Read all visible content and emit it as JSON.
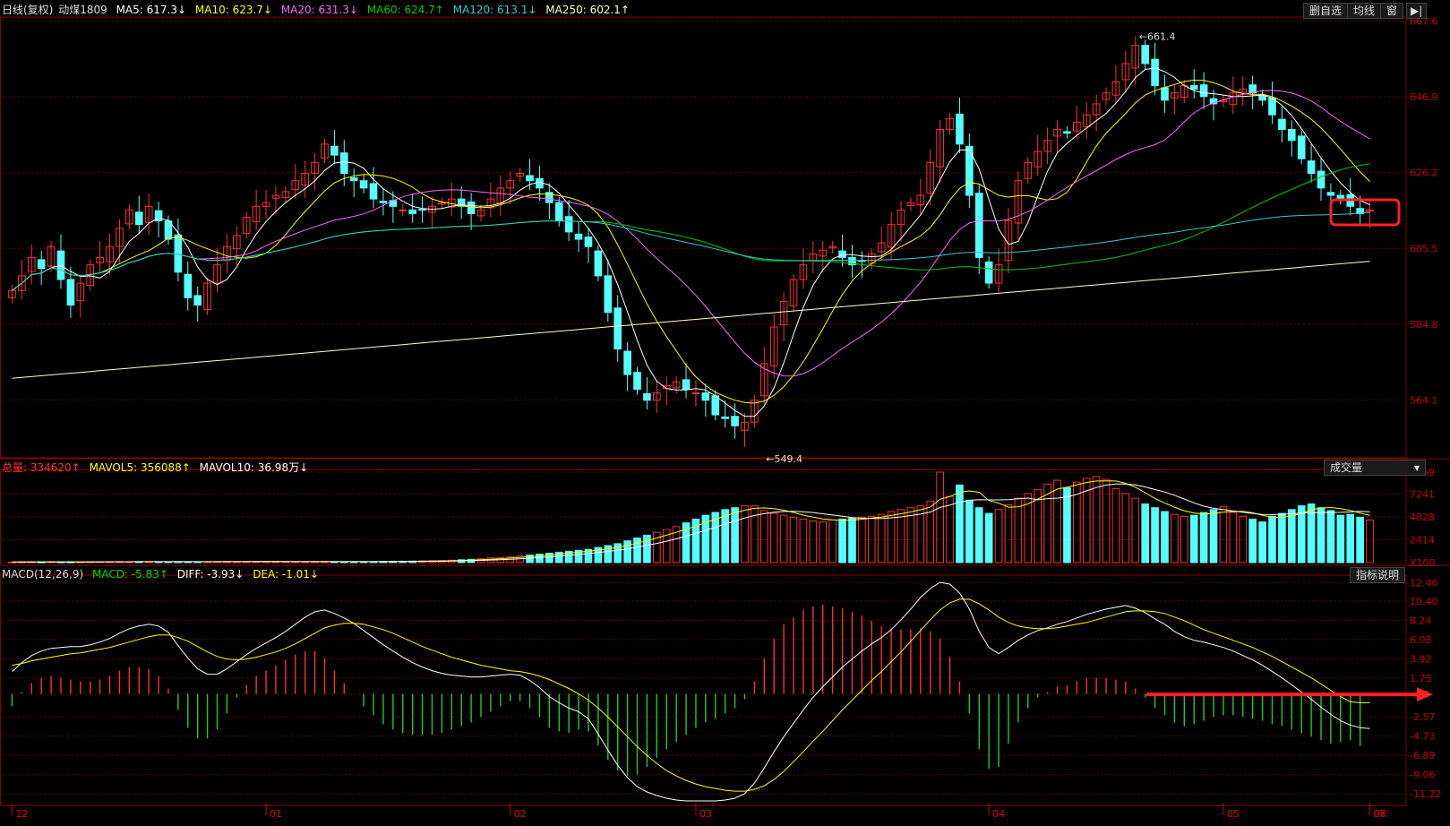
{
  "header": {
    "period": "日线(复权)",
    "symbol": "动煤1809",
    "ma5": "MA5: 617.3↓",
    "ma10": "MA10: 623.7↓",
    "ma20": "MA20: 631.3↓",
    "ma60": "MA60: 624.7↑",
    "ma120": "MA120: 613.1↓",
    "ma250": "MA250: 602.1↑"
  },
  "toolbar": {
    "delete_watch": "删自选",
    "avg_line": "均线",
    "window": "窗",
    "collapse": "▶|"
  },
  "volume_header": {
    "total": "总量: 334620↑",
    "mavol5": "MAVOL5: 356088↑",
    "mavol10": "MAVOL10: 36.98万↓",
    "selector": "成交量"
  },
  "macd_header": {
    "name": "MACD(12,26,9)",
    "macd": "MACD: -5.83↑",
    "diff": "DIFF: -3.93↓",
    "dea": "DEA: -1.01↓",
    "help": "指标说明"
  },
  "annotations": {
    "high": "661.4",
    "low": "549.4"
  },
  "colors": {
    "up": "#ff3030",
    "down": "#54ffff",
    "ma5": "#ffffff",
    "ma10": "#ffff00",
    "ma20": "#ff66ff",
    "ma60": "#00cc00",
    "ma120": "#33cccc",
    "ma250": "#ffffcc",
    "grid": "#660000",
    "axis": "#cc0000",
    "marker": "#ff2020"
  },
  "chart_data": [
    {
      "type": "candlestick",
      "title": "动煤1809",
      "y_ticks": [
        "667.6",
        "646.9",
        "626.2",
        "605.5",
        "584.8",
        "564.1"
      ],
      "ylim": [
        549,
        668
      ],
      "x_ticks": [
        "12",
        "01",
        "02",
        "03",
        "04",
        "05",
        "06",
        "07"
      ],
      "close": [
        594,
        598,
        603,
        600,
        606,
        597,
        590,
        596,
        601,
        603,
        606,
        611,
        616,
        612,
        617,
        613,
        608,
        599,
        592,
        590,
        596,
        601,
        606,
        609,
        614,
        617,
        618,
        620,
        621,
        624,
        626,
        629,
        634,
        631,
        626,
        624,
        622,
        619,
        618,
        617,
        616,
        615,
        616,
        617,
        618,
        619,
        617,
        615,
        616,
        619,
        622,
        624,
        626,
        624,
        622,
        618,
        613,
        610,
        608,
        606,
        598,
        588,
        578,
        571,
        567,
        564,
        566,
        568,
        569,
        567,
        566,
        564,
        560,
        559,
        557,
        558,
        564,
        574,
        584,
        591,
        597,
        601,
        604,
        605,
        606,
        603,
        601,
        602,
        604,
        607,
        612,
        616,
        618,
        620,
        629,
        638,
        641,
        634,
        620,
        603,
        596,
        601,
        613,
        624,
        629,
        632,
        635,
        638,
        637,
        640,
        642,
        645,
        648,
        651,
        656,
        661,
        656,
        650,
        646,
        648,
        650,
        649,
        647,
        645,
        646,
        648,
        649,
        648,
        646,
        642,
        638,
        635,
        630,
        626,
        622,
        620,
        619,
        617,
        615,
        616
      ]
    },
    {
      "type": "bar",
      "title": "成交量",
      "y_ticks": [
        "9559",
        "7241",
        "4828",
        "2414",
        "X100"
      ],
      "ylim": [
        0,
        9559
      ],
      "values": [
        60,
        70,
        80,
        75,
        90,
        85,
        80,
        70,
        90,
        95,
        100,
        110,
        100,
        105,
        110,
        100,
        95,
        90,
        100,
        95,
        100,
        110,
        120,
        100,
        110,
        105,
        120,
        110,
        100,
        95,
        90,
        110,
        120,
        100,
        95,
        90,
        100,
        110,
        120,
        130,
        150,
        160,
        180,
        200,
        220,
        250,
        300,
        350,
        400,
        500,
        550,
        600,
        700,
        800,
        900,
        1000,
        1100,
        1200,
        1300,
        1400,
        1600,
        1800,
        2000,
        2300,
        2600,
        2900,
        3200,
        3500,
        3800,
        4200,
        4600,
        5000,
        5300,
        5600,
        5800,
        6000,
        6000,
        5500,
        5200,
        5000,
        4800,
        4600,
        4400,
        4300,
        4500,
        4600,
        4700,
        4800,
        4900,
        5100,
        5400,
        5600,
        5800,
        6000,
        6500,
        9559,
        7000,
        8200,
        6600,
        5800,
        5200,
        5600,
        6100,
        6800,
        7300,
        7700,
        8300,
        8700,
        7900,
        8500,
        8900,
        9100,
        8800,
        7800,
        7300,
        6800,
        6200,
        5800,
        5400,
        5100,
        4900,
        5000,
        5300,
        5600,
        5900,
        5300,
        4900,
        4600,
        4300,
        4900,
        5200,
        5600,
        6000,
        6200,
        5800,
        5500,
        5000,
        5100,
        4800,
        4500
      ]
    },
    {
      "type": "line",
      "title": "MACD(12,26,9)",
      "y_ticks": [
        "12.46",
        "10.40",
        "8.24",
        "6.08",
        "3.92",
        "1.75",
        "-.07",
        "-2.57",
        "-4.73",
        "-6.89",
        "-9.06",
        "-11.22"
      ],
      "ylim": [
        -12.2,
        13
      ],
      "series": [
        {
          "name": "DIFF",
          "values": [
            2.5,
            3.5,
            4.3,
            4.8,
            5.1,
            5.2,
            5.3,
            5.3,
            5.5,
            5.8,
            6.2,
            6.8,
            7.3,
            7.6,
            7.8,
            7.6,
            6.9,
            5.4,
            4.0,
            2.8,
            2.2,
            2.2,
            2.8,
            3.6,
            4.4,
            5.1,
            5.7,
            6.3,
            7.0,
            7.8,
            8.6,
            9.2,
            9.4,
            9.0,
            8.5,
            7.9,
            7.1,
            6.3,
            5.5,
            4.8,
            4.1,
            3.5,
            3.0,
            2.6,
            2.3,
            2.1,
            2.0,
            1.9,
            1.9,
            2.0,
            2.1,
            2.2,
            2.1,
            1.5,
            0.7,
            -0.3,
            -1.0,
            -1.6,
            -2.0,
            -2.8,
            -4.5,
            -6.3,
            -8.0,
            -9.4,
            -10.4,
            -11.0,
            -11.4,
            -11.7,
            -11.9,
            -12.0,
            -12.0,
            -12.0,
            -12.0,
            -11.9,
            -11.7,
            -11.2,
            -10.0,
            -8.3,
            -6.5,
            -4.8,
            -3.3,
            -1.8,
            -0.4,
            0.8,
            1.9,
            3.0,
            3.9,
            4.8,
            5.6,
            6.3,
            7.2,
            8.3,
            9.5,
            10.8,
            11.8,
            12.5,
            12.3,
            11.3,
            9.5,
            7.0,
            5.2,
            4.5,
            5.2,
            6.0,
            6.6,
            7.1,
            7.4,
            7.8,
            8.1,
            8.5,
            8.9,
            9.2,
            9.5,
            9.7,
            9.9,
            9.6,
            9.1,
            8.4,
            7.8,
            7.0,
            6.4,
            6.0,
            5.8,
            5.5,
            5.2,
            4.8,
            4.3,
            3.8,
            3.2,
            2.5,
            1.8,
            1.0,
            0.2,
            -0.6,
            -1.5,
            -2.3,
            -3.0,
            -3.5,
            -3.8,
            -3.9
          ]
        },
        {
          "name": "DEA",
          "values": [
            3.2,
            3.4,
            3.7,
            3.9,
            4.1,
            4.3,
            4.5,
            4.6,
            4.8,
            5.0,
            5.2,
            5.5,
            5.8,
            6.1,
            6.4,
            6.6,
            6.6,
            6.3,
            5.9,
            5.3,
            4.7,
            4.2,
            3.9,
            3.8,
            3.9,
            4.1,
            4.4,
            4.7,
            5.1,
            5.6,
            6.2,
            6.8,
            7.4,
            7.7,
            7.9,
            7.9,
            7.8,
            7.5,
            7.2,
            6.8,
            6.3,
            5.8,
            5.3,
            4.9,
            4.5,
            4.1,
            3.8,
            3.5,
            3.2,
            3.0,
            2.8,
            2.6,
            2.5,
            2.3,
            2.0,
            1.6,
            1.1,
            0.6,
            0.0,
            -0.7,
            -1.6,
            -2.6,
            -3.7,
            -4.8,
            -5.9,
            -6.9,
            -7.8,
            -8.6,
            -9.2,
            -9.7,
            -10.1,
            -10.4,
            -10.6,
            -10.8,
            -10.9,
            -10.9,
            -10.7,
            -10.3,
            -9.6,
            -8.7,
            -7.6,
            -6.5,
            -5.3,
            -4.2,
            -3.0,
            -1.8,
            -0.7,
            0.4,
            1.5,
            2.5,
            3.6,
            4.7,
            5.9,
            7.1,
            8.3,
            9.4,
            10.2,
            10.6,
            10.6,
            10.1,
            9.4,
            8.6,
            8.0,
            7.6,
            7.4,
            7.3,
            7.3,
            7.4,
            7.6,
            7.8,
            8.0,
            8.3,
            8.6,
            8.9,
            9.2,
            9.3,
            9.3,
            9.2,
            9.0,
            8.6,
            8.2,
            7.7,
            7.2,
            6.8,
            6.4,
            6.0,
            5.6,
            5.2,
            4.7,
            4.2,
            3.6,
            3.0,
            2.4,
            1.8,
            1.1,
            0.4,
            -0.3,
            -0.9,
            -1.0,
            -1.0
          ]
        },
        {
          "name": "MACD",
          "values": [
            -1.4,
            0.2,
            1.2,
            1.8,
            2.0,
            1.8,
            1.6,
            1.4,
            1.4,
            1.6,
            2.0,
            2.6,
            3.0,
            3.0,
            2.8,
            2.0,
            0.6,
            -1.8,
            -3.8,
            -5.0,
            -5.0,
            -4.0,
            -2.2,
            -0.4,
            1.0,
            2.0,
            2.6,
            3.2,
            3.8,
            4.4,
            4.8,
            4.8,
            4.0,
            2.6,
            1.2,
            0.0,
            -1.4,
            -2.4,
            -3.4,
            -4.0,
            -4.4,
            -4.6,
            -4.6,
            -4.6,
            -4.4,
            -4.0,
            -3.6,
            -3.2,
            -2.6,
            -2.0,
            -1.4,
            -0.8,
            -0.8,
            -1.6,
            -2.6,
            -3.8,
            -4.2,
            -4.4,
            -4.0,
            -4.2,
            -5.8,
            -7.4,
            -8.6,
            -9.2,
            -9.0,
            -8.2,
            -7.2,
            -6.2,
            -5.4,
            -4.6,
            -3.8,
            -3.2,
            -2.8,
            -2.2,
            -1.6,
            -0.6,
            1.4,
            4.0,
            6.2,
            7.8,
            8.6,
            9.4,
            9.8,
            10.0,
            9.8,
            9.6,
            9.2,
            8.8,
            8.2,
            7.6,
            7.2,
            7.2,
            7.2,
            7.4,
            7.0,
            6.2,
            4.2,
            1.4,
            -2.2,
            -6.2,
            -8.4,
            -8.2,
            -5.6,
            -3.2,
            -1.6,
            -0.4,
            0.2,
            0.8,
            1.0,
            1.4,
            1.8,
            1.8,
            1.8,
            1.6,
            1.4,
            0.6,
            -0.4,
            -1.6,
            -2.4,
            -3.2,
            -3.6,
            -3.4,
            -3.0,
            -2.6,
            -2.4,
            -2.4,
            -2.6,
            -2.8,
            -3.0,
            -3.4,
            -3.6,
            -4.0,
            -4.4,
            -4.8,
            -5.2,
            -5.6,
            -5.4,
            -5.2,
            -5.83
          ]
        }
      ]
    }
  ]
}
